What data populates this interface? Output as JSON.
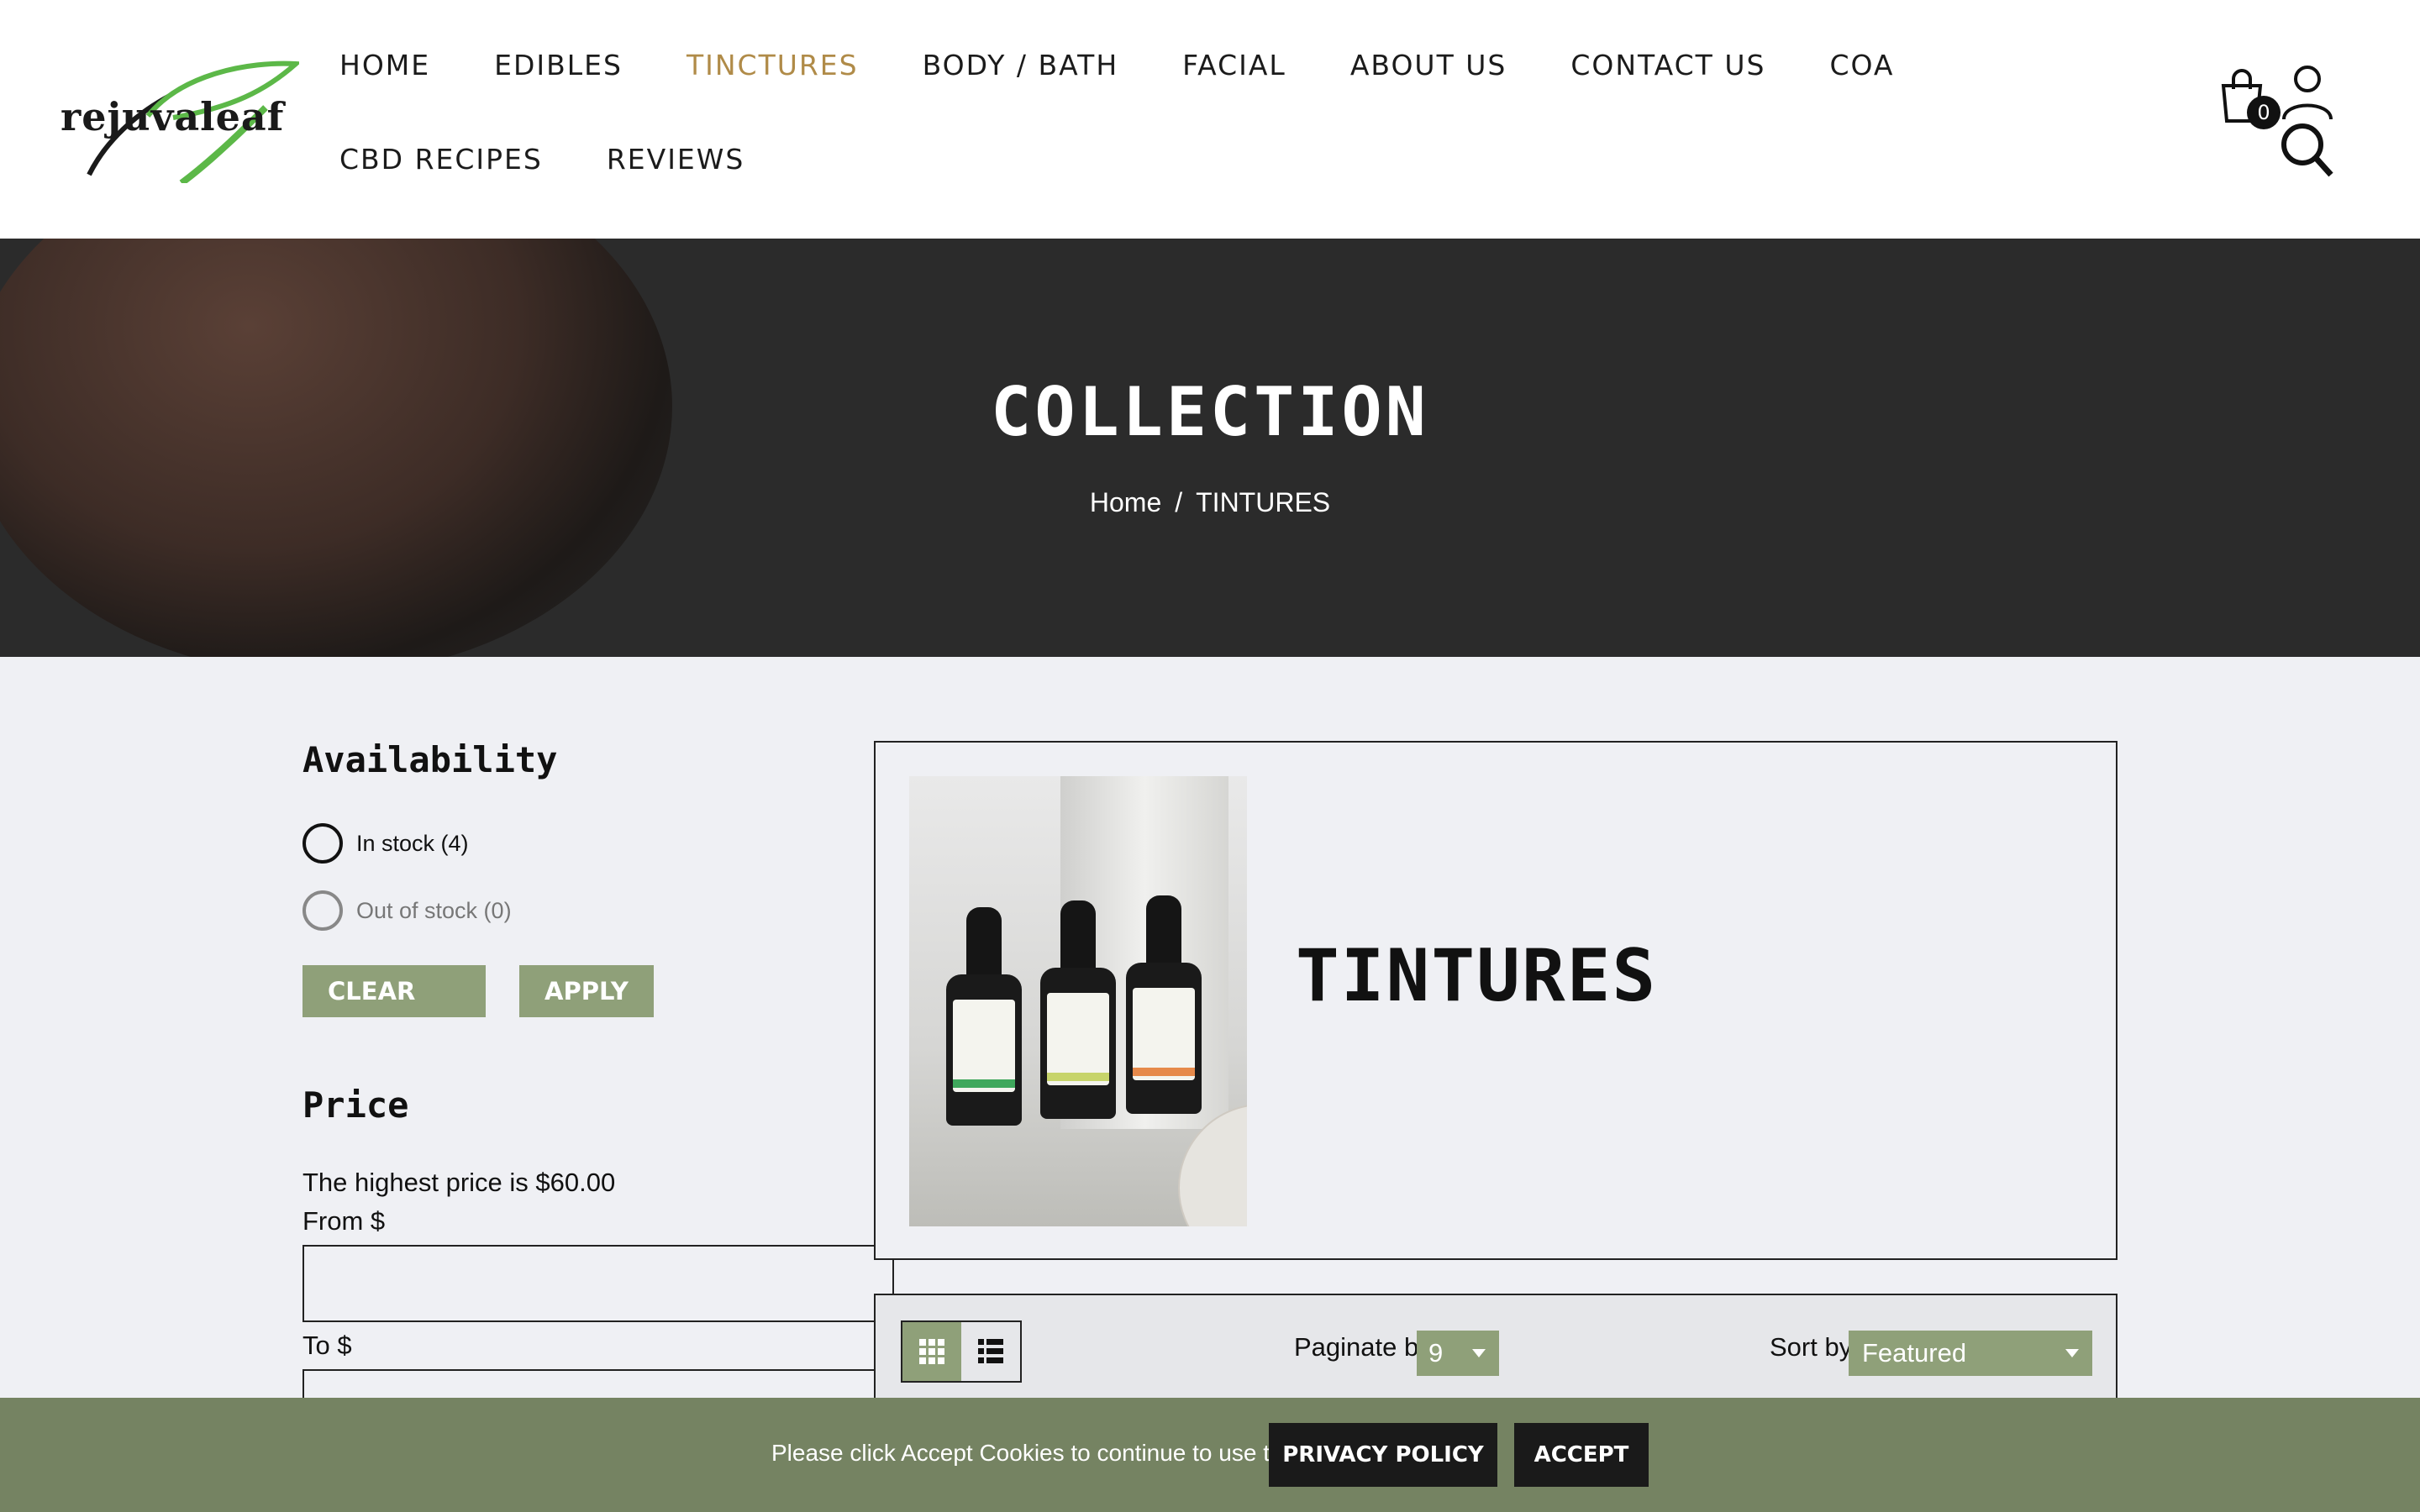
{
  "brand": {
    "logo_text": "rejuvaleaf"
  },
  "nav": {
    "row1": [
      {
        "label": "HOME",
        "name": "nav-home"
      },
      {
        "label": "EDIBLES",
        "name": "nav-edibles"
      },
      {
        "label": "TINCTURES",
        "name": "nav-tinctures",
        "active": true
      },
      {
        "label": "BODY / BATH",
        "name": "nav-body-bath"
      },
      {
        "label": "FACIAL",
        "name": "nav-facial"
      },
      {
        "label": "ABOUT US",
        "name": "nav-about-us"
      },
      {
        "label": "CONTACT US",
        "name": "nav-contact-us"
      },
      {
        "label": "COA",
        "name": "nav-coa"
      }
    ],
    "row2": [
      {
        "label": "CBD RECIPES",
        "name": "nav-cbd-recipes"
      },
      {
        "label": "REVIEWS",
        "name": "nav-reviews"
      }
    ]
  },
  "header_icons": {
    "cart_count": "0",
    "cart": "cart-icon",
    "user": "user-icon",
    "search": "search-icon"
  },
  "hero": {
    "title": "COLLECTION",
    "breadcrumb_home": "Home",
    "breadcrumb_sep": "/",
    "breadcrumb_current": "TINTURES"
  },
  "filters": {
    "availability_title": "Availability",
    "in_stock": "In stock (4)",
    "out_of_stock": "Out of stock (0)",
    "clear_label": "CLEAR",
    "apply_label": "APPLY",
    "price_title": "Price",
    "price_note": "The highest price is $60.00",
    "from_label": "From $",
    "to_label": "To $"
  },
  "collection": {
    "title": "TINTURES"
  },
  "toolbar": {
    "paginate_label": "Paginate by",
    "paginate_value": "9",
    "sort_label": "Sort by",
    "sort_value": "Featured"
  },
  "cookie": {
    "text": "Please click Accept Cookies to continue to use the site.",
    "privacy_label": "PRIVACY POLICY",
    "accept_label": "ACCEPT"
  },
  "colors": {
    "accent_green": "#8fa079",
    "cookie_bar": "#758362",
    "active_nav": "#b08b48",
    "hero_bg": "#2b2b2b"
  }
}
